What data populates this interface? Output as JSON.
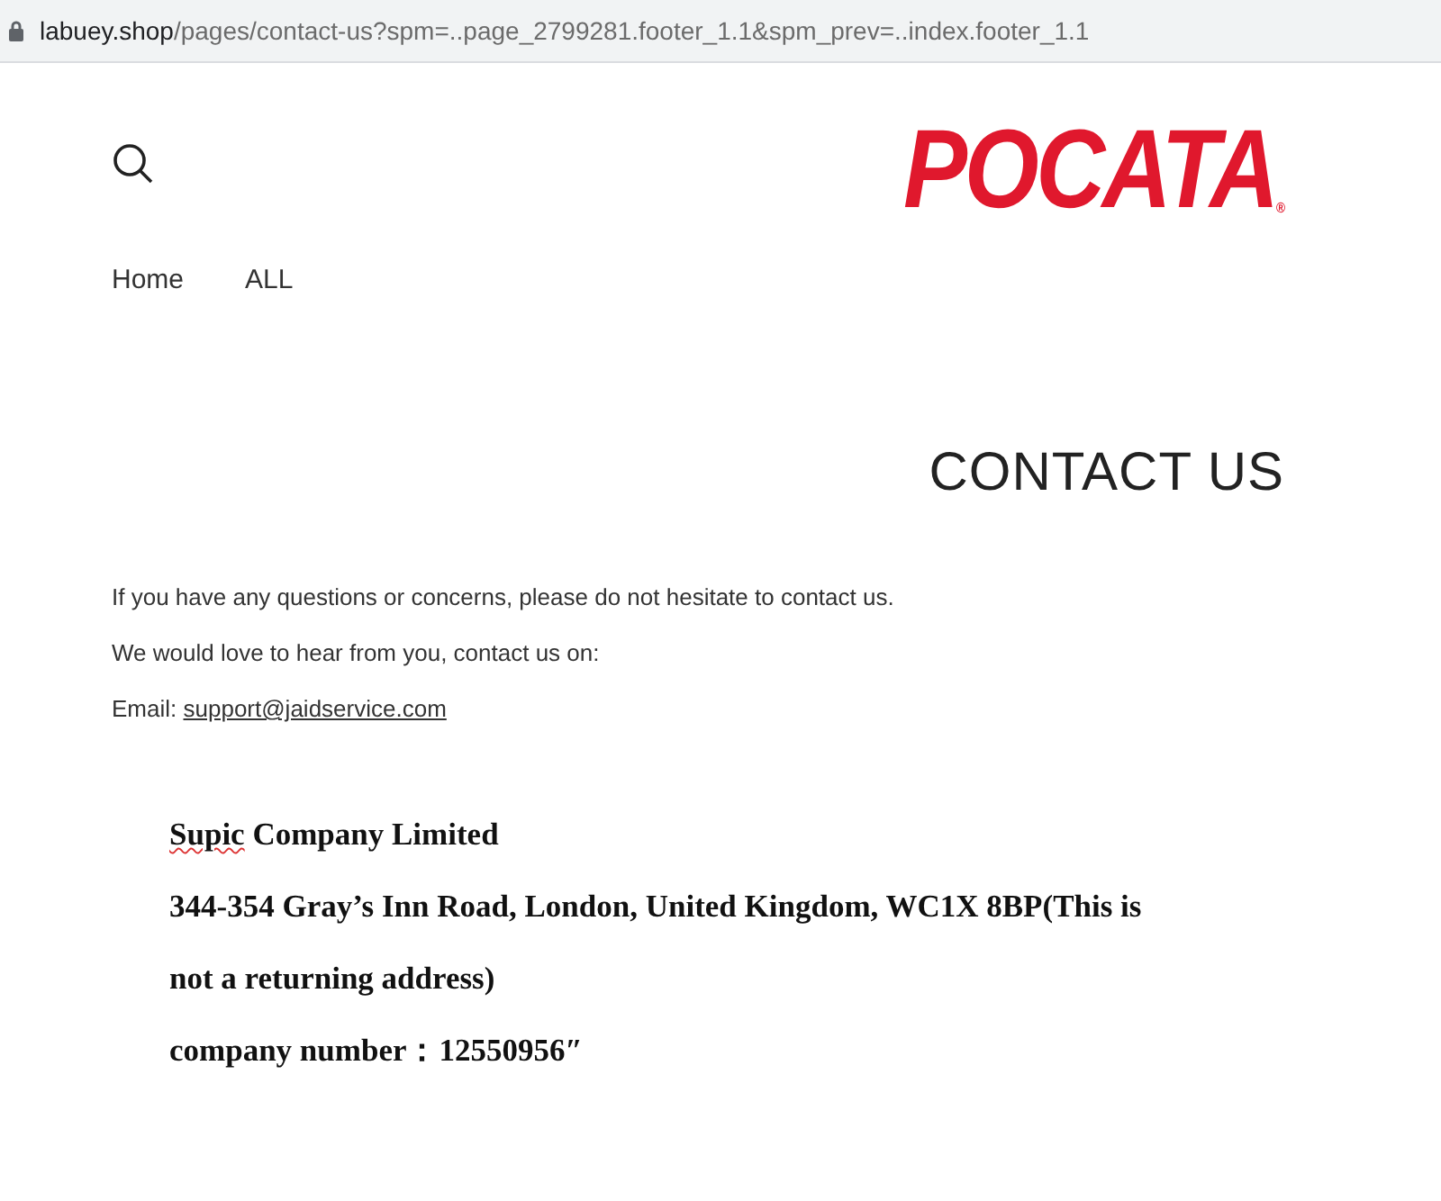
{
  "address_bar": {
    "host": "labuey.shop",
    "path": "/pages/contact-us?spm=..page_2799281.footer_1.1&spm_prev=..index.footer_1.1"
  },
  "header": {
    "logo": "POCATA",
    "logo_mark": "®"
  },
  "nav": [
    {
      "label": "Home"
    },
    {
      "label": "ALL"
    }
  ],
  "page_title": "CONTACT US",
  "intro": [
    "If you have any questions or concerns, please do not hesitate to contact us.",
    "We would love to hear from you, contact us on:"
  ],
  "email": {
    "label": "Email:",
    "address": "support@jaidservice.com"
  },
  "company": {
    "name_misspelled": "Supic",
    "name_rest": "Company Limited",
    "address": "344-354 Gray’s Inn Road, London, United Kingdom, WC1X 8BP(This is not a returning address)",
    "number": "company number：12550956″"
  }
}
